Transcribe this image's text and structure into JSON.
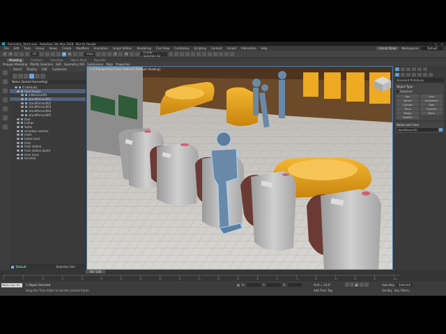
{
  "window": {
    "title": "Animation_Start.max - Autodesk 3ds Max 2018 - Not for Resale",
    "controls": [
      "–",
      "□",
      "✕"
    ]
  },
  "menu": {
    "items": [
      "File",
      "Edit",
      "Tools",
      "Group",
      "Views",
      "Create",
      "Modifiers",
      "Animation",
      "Graph Editors",
      "Rendering",
      "Civil View",
      "Customize",
      "Scripting",
      "Content",
      "Arnold",
      "Interactive",
      "Help"
    ],
    "sign_in": "Fornin Drew",
    "workspaces_label": "Workspaces:",
    "workspace_value": "Default"
  },
  "toolbar": {
    "selection_filter": "All",
    "view": "View",
    "named_selection": "Create Selection Se"
  },
  "ribbon": {
    "tabs": [
      "Modeling",
      "Freeform",
      "Selection",
      "Object Paint",
      "Populate"
    ],
    "active": "Modeling",
    "sub": [
      "Polygon Modeling",
      "Modify Selection",
      "Edit",
      "Geometry (All)",
      "Subdivision",
      "Align",
      "Properties"
    ]
  },
  "explorer": {
    "tabs": [
      "Select",
      "Display",
      "Edit",
      "Customize"
    ],
    "header": "Name (Sorted Ascending)",
    "rows": [
      {
        "label": "0 (default)",
        "indent": 2,
        "hl": false
      },
      {
        "label": "Fake People",
        "indent": 3,
        "hl": true
      },
      {
        "label": "allHuman001",
        "indent": 5,
        "hl": false
      },
      {
        "label": "standPerson001",
        "indent": 5,
        "hl": true
      },
      {
        "label": "standPerson002",
        "indent": 5,
        "hl": false
      },
      {
        "label": "standPerson003",
        "indent": 5,
        "hl": false
      },
      {
        "label": "standPerson004",
        "indent": 5,
        "hl": false
      },
      {
        "label": "standPerson005",
        "indent": 5,
        "hl": false
      },
      {
        "label": "floor",
        "indent": 3,
        "hl": false
      },
      {
        "label": "Lamps",
        "indent": 3,
        "hl": false
      },
      {
        "label": "Sofas",
        "indent": 3,
        "hl": false
      },
      {
        "label": "schedule monitor",
        "indent": 3,
        "hl": false
      },
      {
        "label": "seats",
        "indent": 3,
        "hl": false
      },
      {
        "label": "ticket kiosk",
        "indent": 3,
        "hl": false
      },
      {
        "label": "train",
        "indent": 3,
        "hl": false
      },
      {
        "label": "train station",
        "indent": 3,
        "hl": false
      },
      {
        "label": "train station booth",
        "indent": 3,
        "hl": false
      },
      {
        "label": "train track",
        "indent": 3,
        "hl": false
      },
      {
        "label": "turnstile",
        "indent": 3,
        "hl": false
      }
    ],
    "footer_layer": "Default",
    "footer_selection": "Selection Set:"
  },
  "viewport": {
    "label": "[+] [Perspective] [User Defined] [Default Shading]"
  },
  "command_panel": {
    "category": "Standard Primitives",
    "object_type_title": "Object Type",
    "autogrid": "AutoGrid",
    "buttons": [
      "Box",
      "Cone",
      "Sphere",
      "GeoSphere",
      "Cylinder",
      "Tube",
      "Torus",
      "Pyramid",
      "Teapot",
      "Plane",
      "TextPlus"
    ],
    "name_color_title": "Name and Color",
    "name_value": "standPerson001"
  },
  "timeline": {
    "slider": "36 / 100",
    "ticks": [
      "0",
      "5",
      "10",
      "15",
      "20",
      "25",
      "30",
      "35",
      "40",
      "45",
      "50",
      "55",
      "60",
      "65",
      "70",
      "75",
      "80",
      "85",
      "90",
      "95",
      "100"
    ]
  },
  "status": {
    "maxscript": "MAXScript Mi",
    "selected": "1 Object Selected",
    "prompt": "Drag the Time Slider to set the current frame",
    "x_label": "X:",
    "y_label": "Y:",
    "z_label": "Z:",
    "grid": "Grid = 10,0\"",
    "add_time_tag": "Add Time Tag",
    "auto_key": "Auto Key",
    "selected_dd": "Selected",
    "set_key": "Set Key",
    "key_filters": "Key Filters..."
  },
  "colors": {
    "bg_dark": "#3a3a3a",
    "accent": "#5aa0d8",
    "sofa": "#e8a21c",
    "figure": "#6a89a8",
    "turnstile": "#bdbdbd",
    "floor": "#c9c7c2"
  }
}
